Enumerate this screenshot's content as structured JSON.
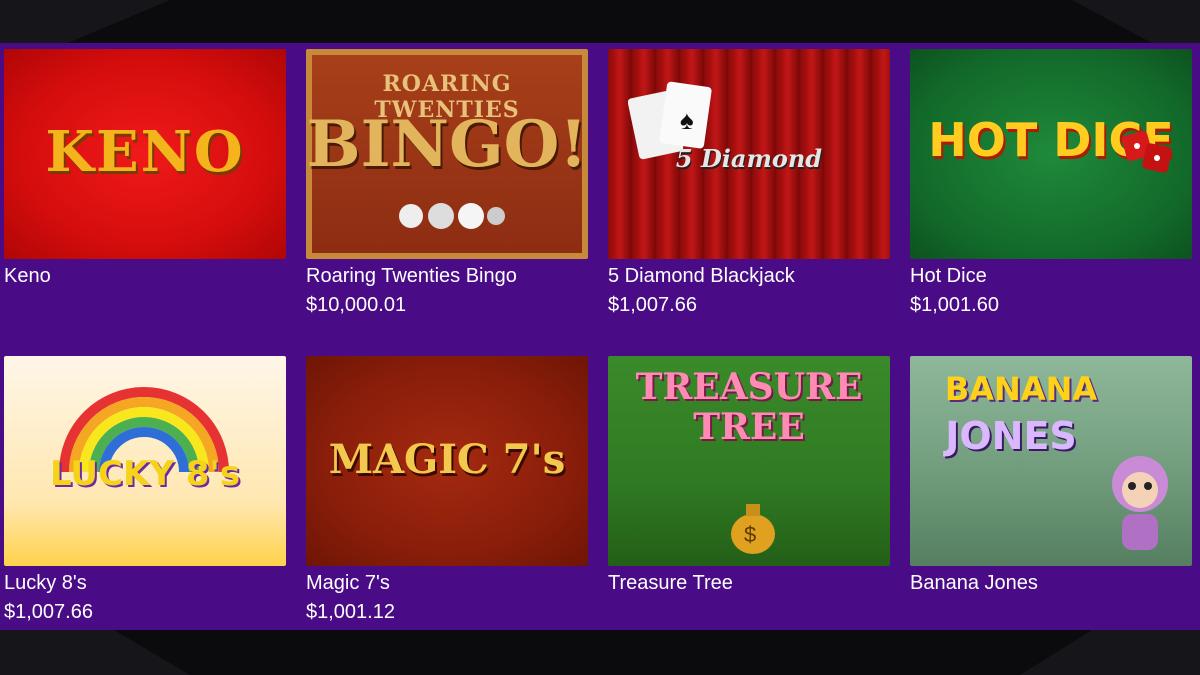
{
  "games": [
    {
      "name": "Keno",
      "amount": "",
      "art": "KENO"
    },
    {
      "name": "Roaring Twenties Bingo",
      "amount": "$10,000.01",
      "art_top": "ROARING TWENTIES",
      "art": "BINGO!"
    },
    {
      "name": "5 Diamond Blackjack",
      "amount": "$1,007.66",
      "art": "5 Diamond"
    },
    {
      "name": "Hot Dice",
      "amount": "$1,001.60",
      "art": "HOT DICE"
    },
    {
      "name": "Lucky 8's",
      "amount": "$1,007.66",
      "art": "LUCKY 8's"
    },
    {
      "name": "Magic 7's",
      "amount": "$1,001.12",
      "art": "MAGIC 7's"
    },
    {
      "name": "Treasure Tree",
      "amount": "",
      "art_top": "TREASURE",
      "art": "TREE"
    },
    {
      "name": "Banana Jones",
      "amount": "",
      "art_top": "BANANA",
      "art": "JONES"
    }
  ],
  "colors": {
    "panel": "#4a0c86",
    "page": "#0b0b0e"
  }
}
